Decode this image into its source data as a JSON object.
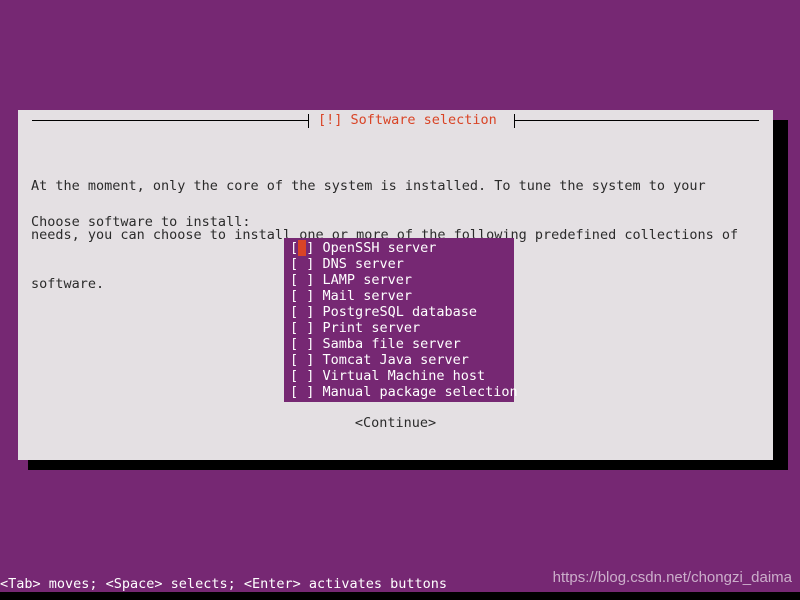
{
  "screen": {
    "background_color": "#762873",
    "dialog_bg_color": "#e4e0e3",
    "accent_color": "#d94426",
    "list_bg_color": "#762873",
    "text_color": "#2b2b2b"
  },
  "dialog": {
    "title": "[!] Software selection",
    "body_lines": [
      "At the moment, only the core of the system is installed. To tune the system to your",
      "needs, you can choose to install one or more of the following predefined collections of",
      "software."
    ],
    "prompt": "Choose software to install:"
  },
  "software_list": {
    "items": [
      {
        "checkbox_open": "[",
        "checkbox_mark": " ",
        "checkbox_close": "]",
        "label": "OpenSSH server",
        "checked": false,
        "cursor": true
      },
      {
        "checkbox_open": "[",
        "checkbox_mark": " ",
        "checkbox_close": "]",
        "label": "DNS server",
        "checked": false,
        "cursor": false
      },
      {
        "checkbox_open": "[",
        "checkbox_mark": " ",
        "checkbox_close": "]",
        "label": "LAMP server",
        "checked": false,
        "cursor": false
      },
      {
        "checkbox_open": "[",
        "checkbox_mark": " ",
        "checkbox_close": "]",
        "label": "Mail server",
        "checked": false,
        "cursor": false
      },
      {
        "checkbox_open": "[",
        "checkbox_mark": " ",
        "checkbox_close": "]",
        "label": "PostgreSQL database",
        "checked": false,
        "cursor": false
      },
      {
        "checkbox_open": "[",
        "checkbox_mark": " ",
        "checkbox_close": "]",
        "label": "Print server",
        "checked": false,
        "cursor": false
      },
      {
        "checkbox_open": "[",
        "checkbox_mark": " ",
        "checkbox_close": "]",
        "label": "Samba file server",
        "checked": false,
        "cursor": false
      },
      {
        "checkbox_open": "[",
        "checkbox_mark": " ",
        "checkbox_close": "]",
        "label": "Tomcat Java server",
        "checked": false,
        "cursor": false
      },
      {
        "checkbox_open": "[",
        "checkbox_mark": " ",
        "checkbox_close": "]",
        "label": "Virtual Machine host",
        "checked": false,
        "cursor": false
      },
      {
        "checkbox_open": "[",
        "checkbox_mark": " ",
        "checkbox_close": "]",
        "label": "Manual package selection",
        "checked": false,
        "cursor": false
      }
    ]
  },
  "buttons": {
    "continue_label": "<Continue>"
  },
  "status_bar": {
    "text": "<Tab> moves; <Space> selects; <Enter> activates buttons"
  },
  "watermark": {
    "text": "https://blog.csdn.net/chongzi_daima"
  }
}
